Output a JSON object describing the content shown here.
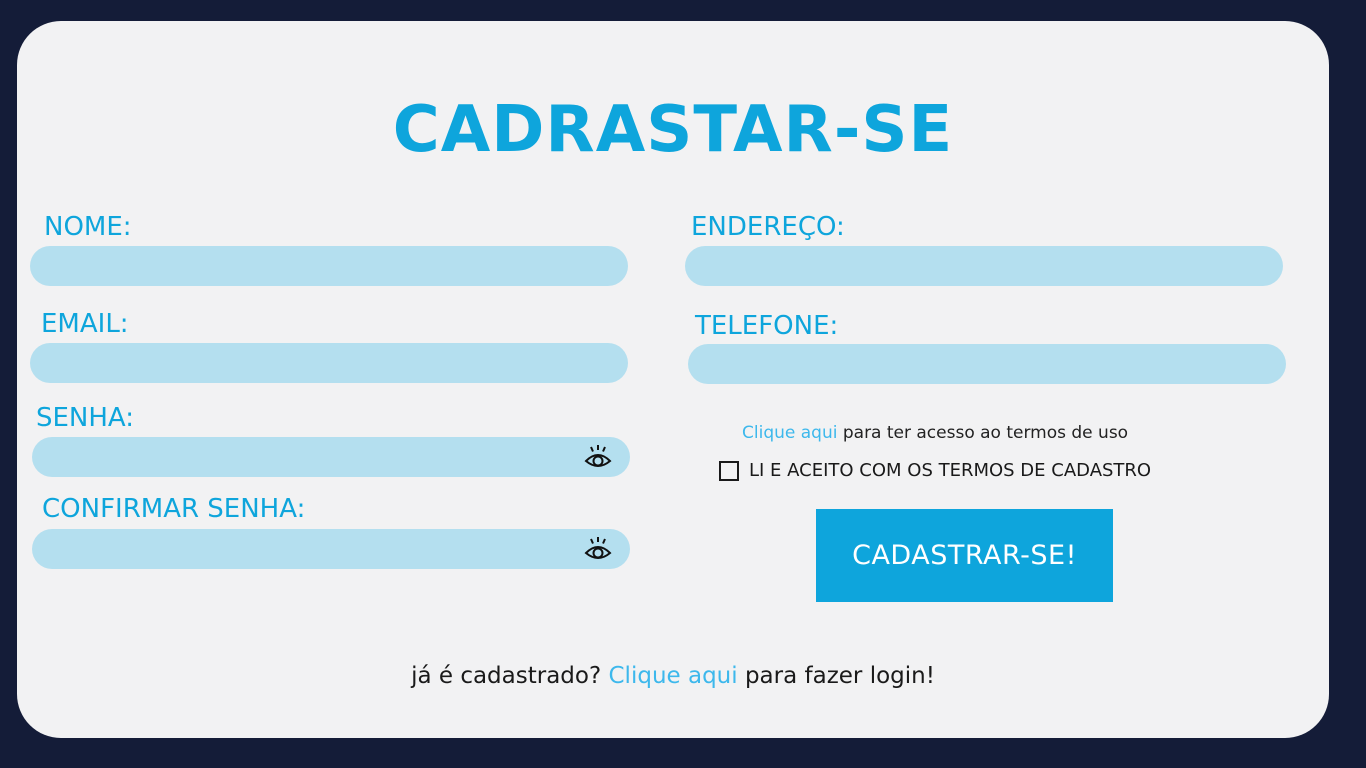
{
  "form": {
    "title": "CADRASTAR-SE",
    "fields": {
      "nome": {
        "label": "NOME:",
        "value": "",
        "placeholder": ""
      },
      "email": {
        "label": "EMAIL:",
        "value": "",
        "placeholder": ""
      },
      "senha": {
        "label": "SENHA:",
        "value": "",
        "placeholder": ""
      },
      "confirmar_senha": {
        "label": "CONFIRMAR SENHA:",
        "value": "",
        "placeholder": ""
      },
      "endereco": {
        "label": "ENDEREÇO:",
        "value": "",
        "placeholder": ""
      },
      "telefone": {
        "label": "TELEFONE:",
        "value": "",
        "placeholder": ""
      }
    },
    "terms": {
      "link_text": "Clique aqui",
      "rest_text": " para ter acesso ao termos de uso",
      "checkbox_label": "LI E ACEITO COM OS TERMOS DE CADASTRO",
      "checked": false
    },
    "submit_label": "CADASTRAR-SE!",
    "footer": {
      "prefix": "já é cadastrado? ",
      "link_text": "Clique aqui",
      "suffix": " para fazer login!"
    }
  },
  "icons": {
    "password_toggle": "eye-icon"
  },
  "colors": {
    "page_background": "#141c38",
    "card_background": "#f2f2f3",
    "accent": "#0ea5dc",
    "field_background": "#b4dfef",
    "link": "#3db8ec"
  }
}
